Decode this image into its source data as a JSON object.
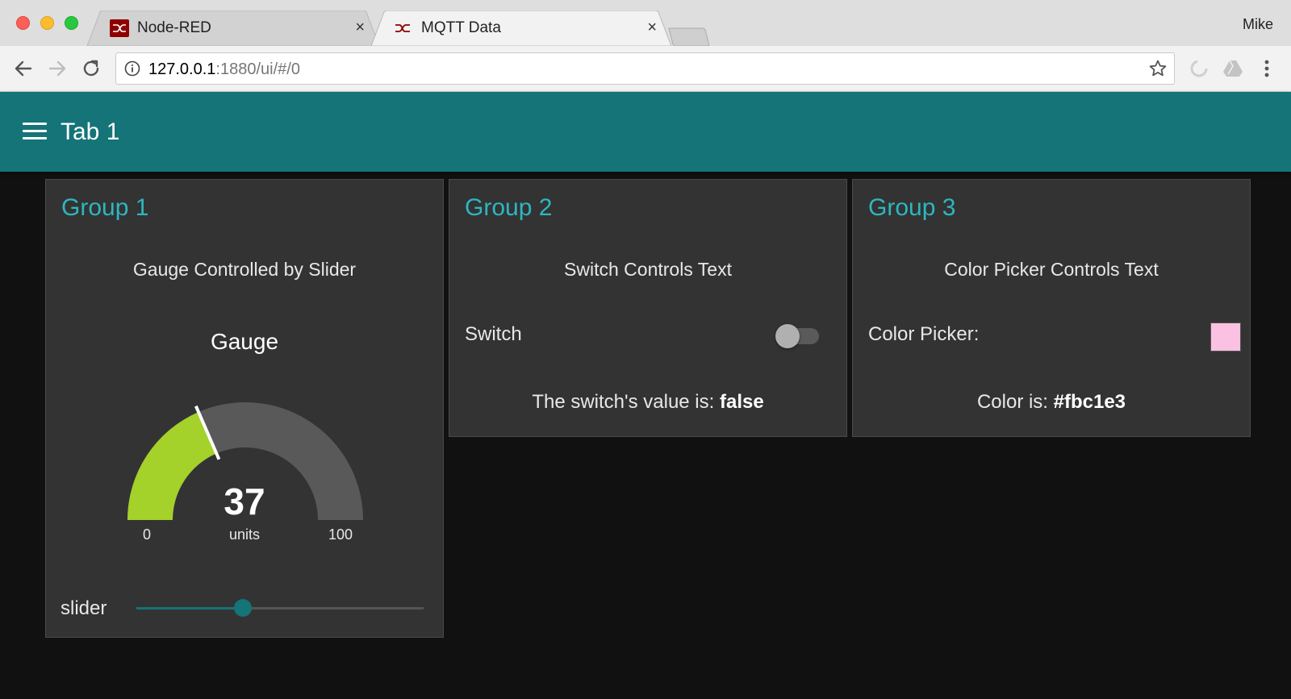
{
  "browser": {
    "tabs": [
      {
        "title": "Node-RED",
        "close": "×",
        "icon": "node-red-favicon"
      },
      {
        "title": "MQTT Data",
        "close": "×",
        "icon": "node-red-favicon"
      }
    ],
    "profile": "Mike",
    "url_host": "127.0.0.1",
    "url_path": ":1880/ui/#/0"
  },
  "dashboard": {
    "header_title": "Tab 1",
    "accent": "#147478",
    "group_title_color": "#2db7c0",
    "groups": [
      {
        "title": "Group 1",
        "text": "Gauge Controlled by Slider",
        "gauge": {
          "title": "Gauge",
          "value": 37,
          "value_text": "37",
          "units": "units",
          "min": "0",
          "max": "100",
          "min_value": 0,
          "max_value": 100,
          "fill_color": "#a4d12a",
          "track_color": "#595959"
        },
        "slider": {
          "label": "slider",
          "value": 37,
          "min": 0,
          "max": 100
        }
      },
      {
        "title": "Group 2",
        "text": "Switch Controls Text",
        "switch": {
          "label": "Switch",
          "state": false
        },
        "result_prefix": "The switch's value is: ",
        "result_value": "false"
      },
      {
        "title": "Group 3",
        "text": "Color Picker Controls Text",
        "color_picker": {
          "label": "Color Picker:",
          "value": "#fbc1e3"
        },
        "result_prefix": "Color is: ",
        "result_value": "#fbc1e3"
      }
    ]
  }
}
